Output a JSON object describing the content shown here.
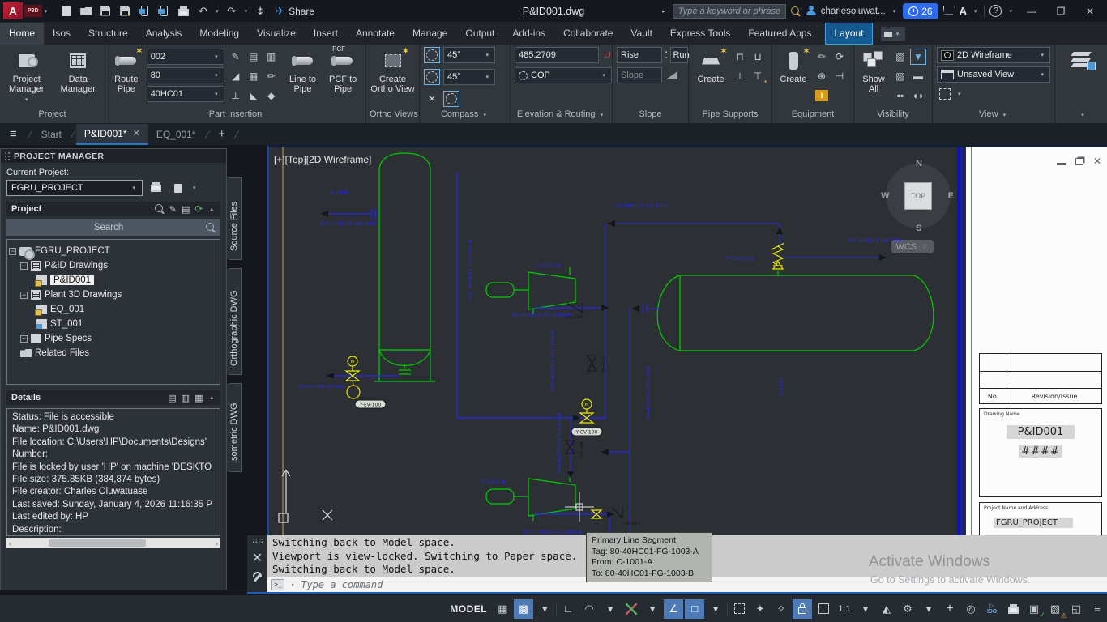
{
  "titlebar": {
    "app_badge": "A",
    "app_badge_sub": "P3D",
    "share_label": "Share",
    "title": "P&ID001.dwg",
    "search_placeholder": "Type a keyword or phrase",
    "user": "charlesoluwat...",
    "notification_count": "26"
  },
  "ribbon": {
    "tabs": [
      "Home",
      "Isos",
      "Structure",
      "Analysis",
      "Modeling",
      "Visualize",
      "Insert",
      "Annotate",
      "Manage",
      "Output",
      "Add-ins",
      "Collaborate",
      "Vault",
      "Express Tools",
      "Featured Apps"
    ],
    "layout_tab": "Layout",
    "panels": {
      "project": {
        "label": "Project",
        "project_manager_1": "Project",
        "project_manager_2": "Manager",
        "data_manager_1": "Data",
        "data_manager_2": "Manager"
      },
      "part_insertion": {
        "label": "Part Insertion",
        "route_1": "Route",
        "route_2": "Pipe",
        "size": "002",
        "rating": "80",
        "spec": "40HC01",
        "line_to_pipe_1": "Line to",
        "line_to_pipe_2": "Pipe",
        "pcf_to_pipe_1": "PCF to",
        "pcf_to_pipe_2": "Pipe",
        "pcf": "PCF"
      },
      "ortho_views": {
        "label": "Ortho Views",
        "create_1": "Create",
        "create_2": "Ortho View"
      },
      "compass": {
        "label": "Compass",
        "angle1": "45°",
        "angle2": "45°"
      },
      "elevation_routing": {
        "label": "Elevation & Routing",
        "elevation": "485.2709",
        "routing_mode": "COP"
      },
      "slope": {
        "label": "Slope",
        "rise": "Rise",
        "colon": ":",
        "run": "Run",
        "slope_placeholder": "Slope"
      },
      "pipe_supports": {
        "label": "Pipe Supports",
        "create": "Create"
      },
      "equipment": {
        "label": "Equipment",
        "create": "Create"
      },
      "visibility": {
        "label": "Visibility",
        "show_all_1": "Show",
        "show_all_2": "All"
      },
      "view": {
        "label": "View",
        "visual_style": "2D Wireframe",
        "named_view": "Unsaved View"
      },
      "layers": {
        "label": "Layers"
      }
    }
  },
  "file_tabs": {
    "start": "Start",
    "active": "P&ID001*",
    "second": "EQ_001*"
  },
  "project_manager": {
    "title": "PROJECT MANAGER",
    "current_project_label": "Current Project:",
    "current_project": "FGRU_PROJECT",
    "section_title": "Project",
    "search_placeholder": "Search",
    "tree": {
      "root": "FGRU_PROJECT",
      "pid_drawings": "P&ID Drawings",
      "pid001": "P&ID001",
      "plant3d_drawings": "Plant 3D Drawings",
      "eq001": "EQ_001",
      "st001": "ST_001",
      "pipe_specs": "Pipe Specs",
      "related_files": "Related Files"
    },
    "side_tabs": [
      "Source Files",
      "Orthographic DWG",
      "Isometric DWG"
    ]
  },
  "details": {
    "title": "Details",
    "lines": [
      "Status: File is accessible",
      "Name: P&ID001.dwg",
      "File location: C:\\Users\\HP\\Documents\\Designs'",
      "Number:",
      "File is locked by user 'HP' on machine 'DESKTO",
      "File size: 375.85KB (384,874 bytes)",
      "File creator: Charles Oluwatuase",
      "Last saved: Sunday, January 4, 2026 11:16:35 P",
      "Last edited by: HP",
      "Description:"
    ]
  },
  "drawing": {
    "viewport_label": "[+][Top][2D Wireframe]",
    "viewcube": {
      "top": "TOP",
      "n": "N",
      "s": "S",
      "e": "E",
      "w": "W",
      "wcs": "WCS"
    },
    "labels": {
      "v1000": "V-1000",
      "wr1007": "150-40HD01-WR-1007",
      "fg1002a_riser": "150-30HD01-FG-1002-A",
      "c1001b": "C-1001-B",
      "fg1005": "50-40HC01-FG-1005",
      "psv1001": "Y-PSV-1001",
      "rv1006": "80-40HD01-RV-1006",
      "v1002": "V-1002",
      "fg1003b": "80-40HC01-FG-1003-B",
      "ha1127": "HA-1127",
      "fg1002b": "100-40HC01-FG-1002-B",
      "ha131": "HA-131",
      "cv100": "Y-CV-100",
      "fg1002a": "100-40HC01-FG-1002-A",
      "ha108": "HA-108",
      "fg1004": "80-40HC01-FG-1004",
      "c1001a": "C-1001-A",
      "ha113": "HA-113",
      "fg1003a": "80-40HC01-FG-1003-A",
      "ev100": "Y-EV-100",
      "sw1010": "100-30HC01-SW-1010"
    },
    "titleblock": {
      "no": "No.",
      "revision": "Revision/Issue",
      "drawing_name_label": "Drawing Name",
      "drawing_name": "P&ID001",
      "sheet": "####",
      "project_label": "Project Name and Address",
      "project_name": "FGRU_PROJECT"
    },
    "tooltip": {
      "title": "Primary Line Segment",
      "tag": "Tag: 80-40HC01-FG-1003-A",
      "from": "From: C-1001-A",
      "to": "To: 80-40HC01-FG-1003-B"
    },
    "watermark": {
      "line1": "Activate Windows",
      "line2": "Go to Settings to activate Windows."
    }
  },
  "command": {
    "lines": [
      "Switching back to Model space.",
      "Viewport is view-locked. Switching to Paper space.",
      "Switching back to Model space."
    ],
    "prompt": "Type a command"
  },
  "statusbar": {
    "model": "MODEL",
    "scale": "1:1"
  }
}
